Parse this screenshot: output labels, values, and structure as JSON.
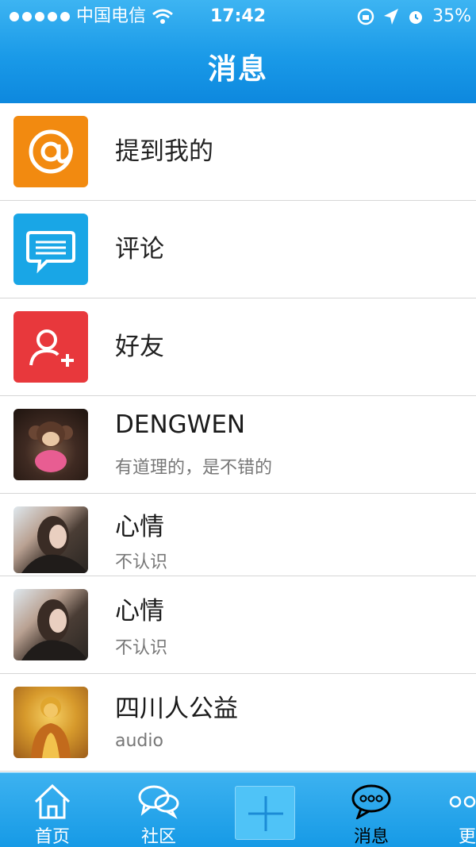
{
  "status_bar": {
    "carrier": "中国电信",
    "time": "17:42",
    "battery": "35%"
  },
  "nav": {
    "title": "消息"
  },
  "items": [
    {
      "type": "icon",
      "icon": "at-icon",
      "title": "提到我的",
      "color": "#f28a10"
    },
    {
      "type": "icon",
      "icon": "comment-icon",
      "title": "评论",
      "color": "#19a6e6"
    },
    {
      "type": "icon",
      "icon": "add-friend-icon",
      "title": "好友",
      "color": "#e8383c"
    },
    {
      "type": "avatar",
      "name": "DENGWEN",
      "message": "有道理的，是不错的"
    },
    {
      "type": "avatar",
      "name": "心情",
      "message": "不认识"
    },
    {
      "type": "avatar",
      "name": "心情",
      "message": "不认识"
    },
    {
      "type": "avatar",
      "name": "四川人公益",
      "message": "audio"
    }
  ],
  "tabbar": {
    "home": "首页",
    "community": "社区",
    "messages": "消息",
    "more": "更"
  }
}
